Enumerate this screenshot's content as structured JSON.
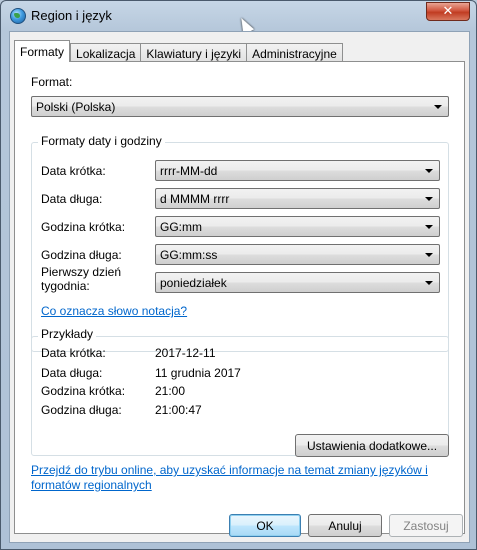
{
  "window": {
    "title": "Region i język",
    "close_glyph": "✕"
  },
  "tabs": [
    {
      "label": "Formaty",
      "active": true
    },
    {
      "label": "Lokalizacja",
      "active": false
    },
    {
      "label": "Klawiatury i języki",
      "active": false
    },
    {
      "label": "Administracyjne",
      "active": false
    }
  ],
  "format": {
    "label": "Format:",
    "value": "Polski (Polska)"
  },
  "date_time": {
    "group_title": "Formaty daty i godziny",
    "rows": [
      {
        "label": "Data krótka:",
        "value": "rrrr-MM-dd"
      },
      {
        "label": "Data długa:",
        "value": "d MMMM rrrr"
      },
      {
        "label": "Godzina krótka:",
        "value": "GG:mm"
      },
      {
        "label": "Godzina długa:",
        "value": "GG:mm:ss"
      },
      {
        "label": "Pierwszy dzień tygodnia:",
        "value": "poniedziałek"
      }
    ],
    "notation_link": "Co oznacza słowo notacja?"
  },
  "examples": {
    "group_title": "Przykłady",
    "rows": [
      {
        "label": "Data krótka:",
        "value": "2017-12-11"
      },
      {
        "label": "Data długa:",
        "value": "11 grudnia 2017"
      },
      {
        "label": "Godzina krótka:",
        "value": "21:00"
      },
      {
        "label": "Godzina długa:",
        "value": "21:00:47"
      }
    ]
  },
  "additional_settings_button": "Ustawienia dodatkowe...",
  "online_link": "Przejdź do trybu online, aby uzyskać informacje na temat zmiany języków i formatów regionalnych",
  "footer": {
    "ok": "OK",
    "cancel": "Anuluj",
    "apply": "Zastosuj"
  },
  "icons": {
    "title": "globe-icon",
    "dropdown": "chevron-down-icon",
    "close": "close-icon"
  }
}
